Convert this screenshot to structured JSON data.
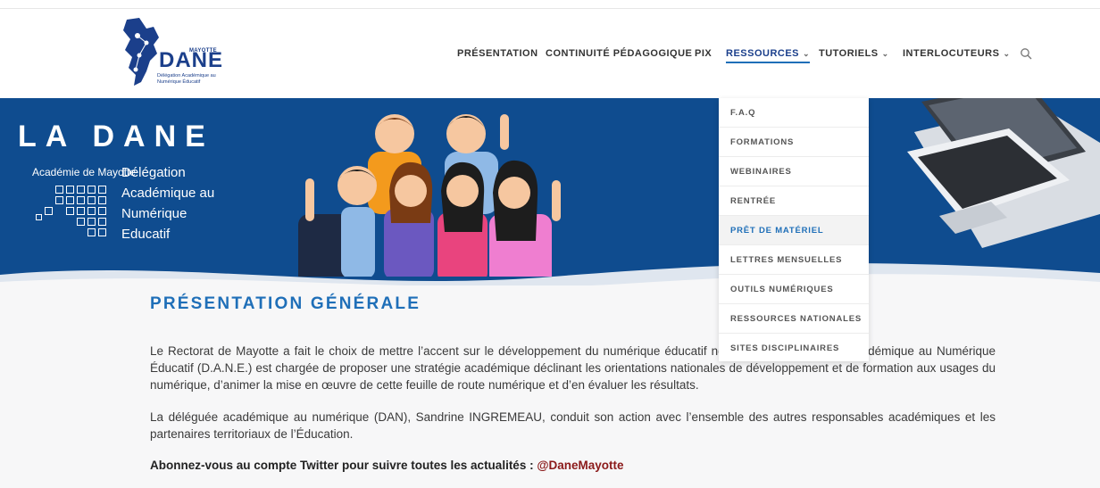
{
  "logo": {
    "region": "MAYOTTE",
    "name": "DANE",
    "subtitle": "Délégation Académique au Numérique Éducatif"
  },
  "nav": {
    "items": [
      {
        "label": "PRÉSENTATION",
        "has_dropdown": false
      },
      {
        "label": "CONTINUITÉ PÉDAGOGIQUE",
        "has_dropdown": false
      },
      {
        "label": "PIX",
        "has_dropdown": false
      },
      {
        "label": "RESSOURCES",
        "has_dropdown": true,
        "active": true
      },
      {
        "label": "TUTORIELS",
        "has_dropdown": true
      },
      {
        "label": "INTERLOCUTEURS",
        "has_dropdown": true
      }
    ],
    "chevron": "⌄",
    "search_icon": "search-icon"
  },
  "banner": {
    "title": "LA DANE",
    "academie": "Académie de Mayotte",
    "words": [
      "Délégation",
      "Académique au",
      "Numérique",
      "Educatif"
    ]
  },
  "dropdown": {
    "items": [
      "F.A.Q",
      "FORMATIONS",
      "WEBINAIRES",
      "RENTRÉE",
      "PRÊT DE MATÉRIEL",
      "LETTRES MENSUELLES",
      "OUTILS NUMÉRIQUES",
      "RESSOURCES NATIONALES",
      "SITES DISCIPLINAIRES"
    ],
    "highlighted": "PRÊT DE MATÉRIEL"
  },
  "content": {
    "title": "PRÉSENTATION GÉNÉRALE",
    "p1": "Le Rectorat de Mayotte a fait le choix de mettre l’accent sur le développement du numérique éducatif                                                  nd degré. La Délégation Académique au Numérique Éducatif (D.A.N.E.) est chargée de proposer une stratégie académique déclinant les orientations nationales de développement et de formation aux usages du numérique, d’animer la mise en œuvre de cette feuille de route numérique et d’en évaluer les résultats.",
    "p2": "La déléguée académique au numérique (DAN), Sandrine INGREMEAU, conduit son action avec l’ensemble des autres responsables académiques et les partenaires territoriaux de l’Éducation.",
    "p3_text": "Abonnez-vous au compte Twitter pour suivre toutes les actualités : ",
    "p3_link": "@DaneMayotte"
  },
  "colors": {
    "primary_blue": "#1f6fb8",
    "banner_blue": "#0f4c8f",
    "link_red": "#8b1a1a"
  }
}
